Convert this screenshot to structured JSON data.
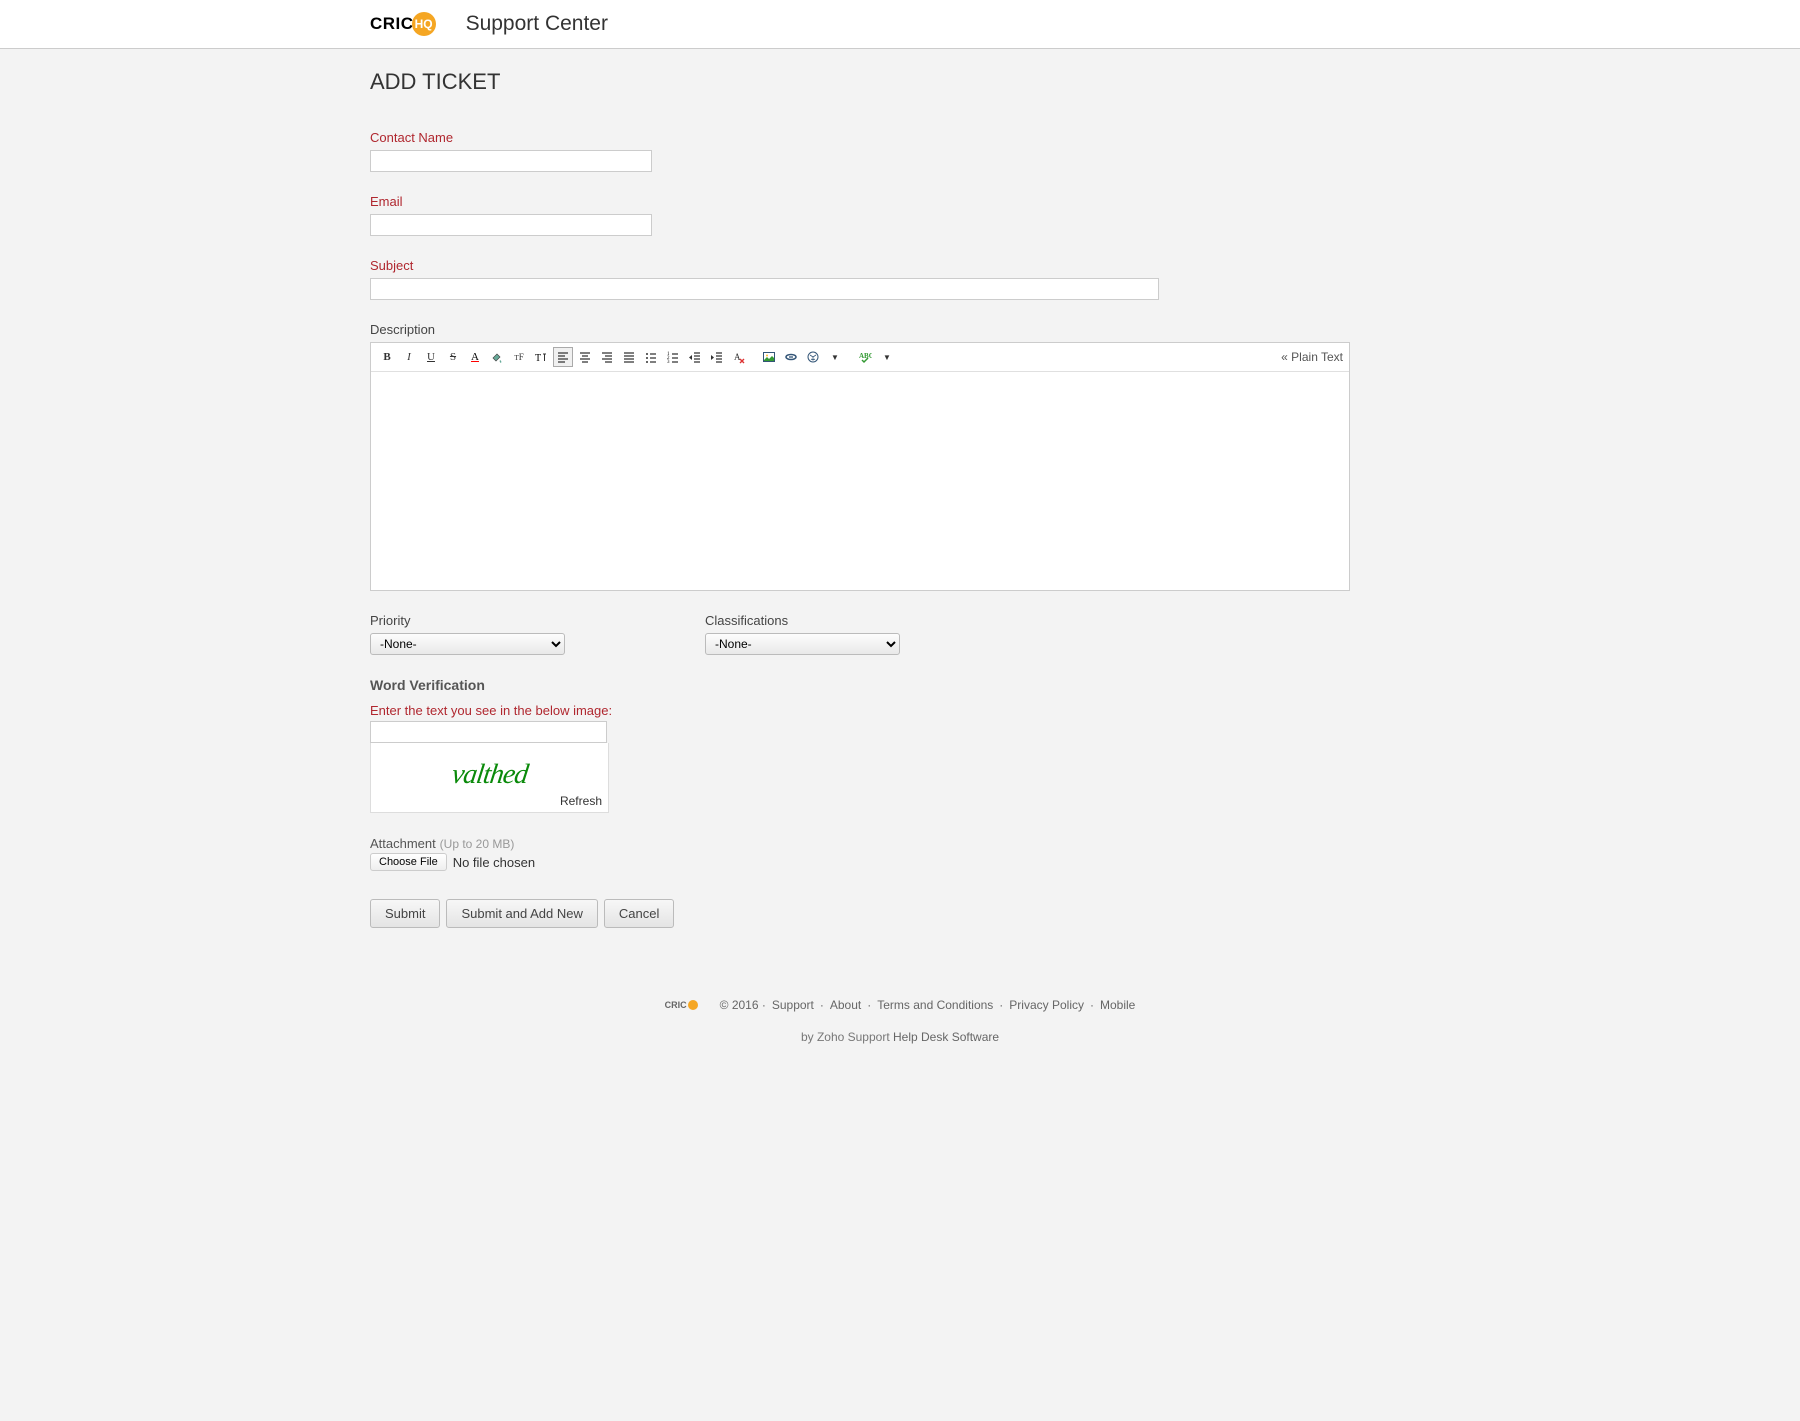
{
  "header": {
    "logo_text": "CRIC",
    "logo_badge": "HQ",
    "title": "Support Center"
  },
  "page": {
    "title": "ADD TICKET"
  },
  "form": {
    "contact_name": {
      "label": "Contact Name",
      "value": ""
    },
    "email": {
      "label": "Email",
      "value": ""
    },
    "subject": {
      "label": "Subject",
      "value": ""
    },
    "description": {
      "label": "Description",
      "value": ""
    },
    "priority": {
      "label": "Priority",
      "value": "-None-"
    },
    "classifications": {
      "label": "Classifications",
      "value": "-None-"
    }
  },
  "editor": {
    "plain_text_label": "« Plain Text"
  },
  "verification": {
    "title": "Word Verification",
    "instruction": "Enter the text you see in the below image:",
    "captcha_text": "valthed",
    "refresh": "Refresh",
    "input_value": ""
  },
  "attachment": {
    "label": "Attachment",
    "hint": "(Up to 20 MB)",
    "button": "Choose File",
    "status": "No file chosen"
  },
  "actions": {
    "submit": "Submit",
    "submit_add_new": "Submit and Add New",
    "cancel": "Cancel"
  },
  "footer": {
    "copyright": "© 2016 ·",
    "links": [
      "Support",
      "About",
      "Terms and Conditions",
      "Privacy Policy",
      "Mobile"
    ],
    "separator": " · ",
    "credit_prefix": "by Zoho Support ",
    "credit_link": "Help Desk Software"
  }
}
